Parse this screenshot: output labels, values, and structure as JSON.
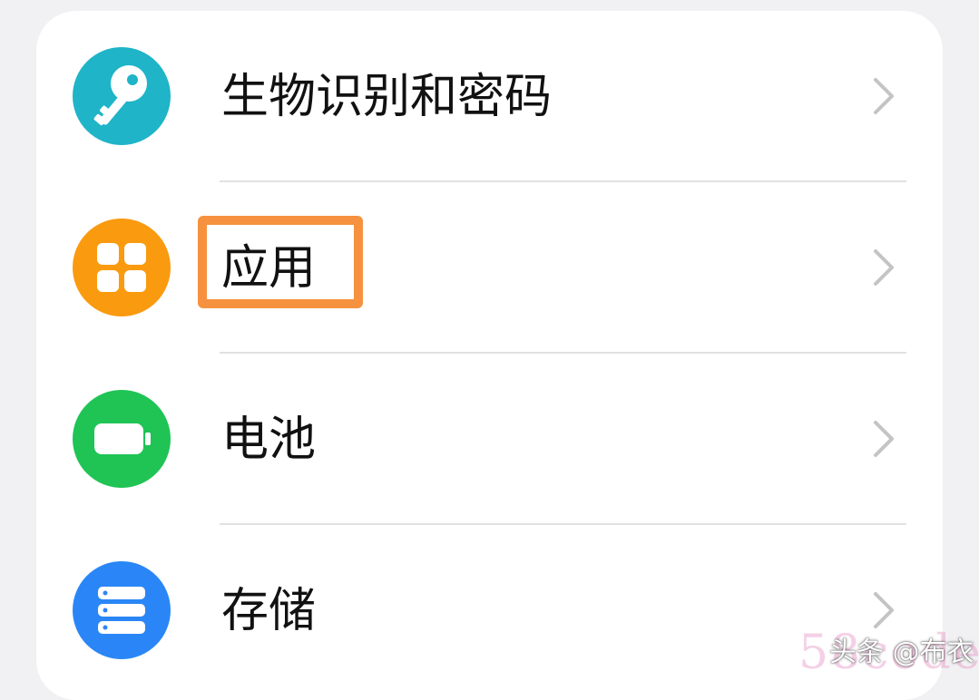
{
  "settings": {
    "items": [
      {
        "label": "生物识别和密码",
        "icon": "key-icon",
        "icon_color": "#1fb4c8"
      },
      {
        "label": "应用",
        "icon": "apps-grid-icon",
        "icon_color": "#fa9a0f"
      },
      {
        "label": "电池",
        "icon": "battery-icon",
        "icon_color": "#1fc455"
      },
      {
        "label": "存储",
        "icon": "storage-icon",
        "icon_color": "#2a86f6"
      }
    ]
  },
  "highlight_color": "#f6923f",
  "watermark": {
    "text": "头条 @布衣",
    "background_text": "58codes"
  }
}
